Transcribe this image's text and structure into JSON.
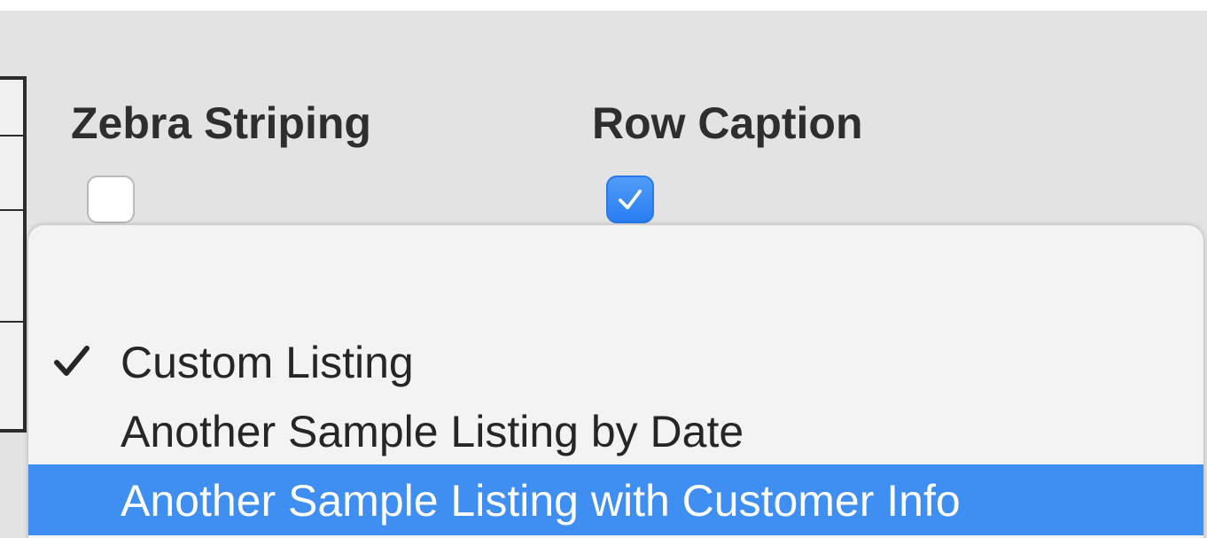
{
  "columns": {
    "zebra_striping": {
      "label": "Zebra Striping",
      "checked": false
    },
    "row_caption": {
      "label": "Row Caption",
      "checked": true
    }
  },
  "dropdown": {
    "items": [
      {
        "label": "Custom Listing",
        "selected": true,
        "highlighted": false
      },
      {
        "label": "Another Sample Listing by Date",
        "selected": false,
        "highlighted": false
      },
      {
        "label": "Another Sample Listing with Customer Info",
        "selected": false,
        "highlighted": true
      }
    ]
  },
  "colors": {
    "highlight": "#3f8ef2",
    "checkbox_checked": "#2a7ef2",
    "background": "#e3e3e3"
  },
  "icons": {
    "menu_selected": "checkmark-icon",
    "checkbox_checked": "checkmark-icon"
  }
}
